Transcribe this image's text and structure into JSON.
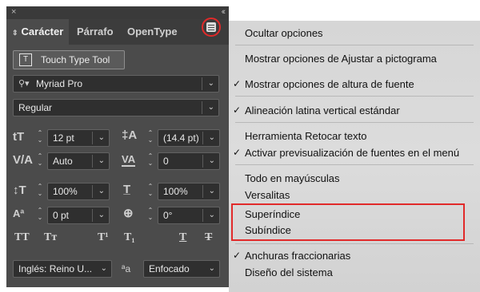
{
  "panel": {
    "tabs": [
      {
        "label": "Carácter",
        "active": true
      },
      {
        "label": "Párrafo",
        "active": false
      },
      {
        "label": "OpenType",
        "active": false
      }
    ],
    "touch_type_button": "Touch Type Tool",
    "font_family": "Myriad Pro",
    "font_style": "Regular",
    "font_size": "12 pt",
    "leading": "(14.4 pt)",
    "kerning": "Auto",
    "tracking": "0",
    "vertical_scale": "100%",
    "horizontal_scale": "100%",
    "baseline_shift": "0 pt",
    "character_rotation": "0°",
    "language": "Inglés: Reino U...",
    "anti_aliasing": "Enfocado",
    "close_glyph": "×",
    "collapse_glyph": "‹‹"
  },
  "menu": {
    "items": [
      {
        "label": "Ocultar opciones",
        "checked": false
      },
      {
        "label": "Mostrar opciones de Ajustar a pictograma",
        "checked": false
      },
      {
        "label": "Mostrar opciones de altura de fuente",
        "checked": true
      },
      {
        "label": "Alineación latina vertical estándar",
        "checked": true
      },
      {
        "label": "Herramienta Retocar texto",
        "checked": false
      },
      {
        "label": "Activar previsualización de fuentes en el menú",
        "checked": true
      },
      {
        "label": "Todo en mayúsculas",
        "checked": false
      },
      {
        "label": "Versalitas",
        "checked": false
      },
      {
        "label": "Superíndice",
        "checked": false
      },
      {
        "label": "Subíndice",
        "checked": false
      },
      {
        "label": "Anchuras fraccionarias",
        "checked": true
      },
      {
        "label": "Diseño del sistema",
        "checked": false
      }
    ]
  },
  "colors": {
    "highlight": "#e12a2a",
    "panel_bg": "#4b4b4b",
    "menu_bg": "#d9d9d9"
  }
}
